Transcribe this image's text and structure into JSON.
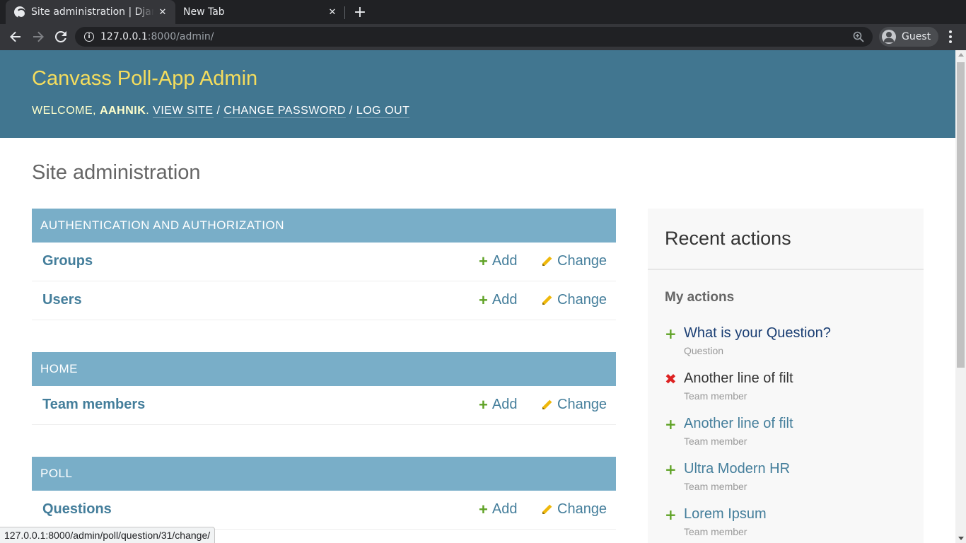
{
  "browser": {
    "tabs": [
      {
        "title": "Site administration | Django site admin",
        "active": true
      },
      {
        "title": "New Tab",
        "active": false
      }
    ],
    "url_host": "127.0.0.1",
    "url_rest": ":8000/admin/",
    "profile_name": "Guest",
    "status_url": "127.0.0.1:8000/admin/poll/question/31/change/"
  },
  "header": {
    "branding": "Canvass Poll-App Admin",
    "welcome": "WELCOME, ",
    "username": "AAHNIK",
    "links": {
      "view_site": "VIEW SITE",
      "change_password": "CHANGE PASSWORD",
      "log_out": "LOG OUT"
    },
    "separator": " / "
  },
  "main": {
    "title": "Site administration",
    "action_add": "Add",
    "action_change": "Change",
    "modules": [
      {
        "caption": "AUTHENTICATION AND AUTHORIZATION",
        "models": [
          "Groups",
          "Users"
        ]
      },
      {
        "caption": "HOME",
        "models": [
          "Team members"
        ]
      },
      {
        "caption": "POLL",
        "models": [
          "Questions"
        ]
      }
    ]
  },
  "recent": {
    "title": "Recent actions",
    "subtitle": "My actions",
    "items": [
      {
        "label": "What is your Question?",
        "type": "Question",
        "action": "add",
        "icon": "plus-icon"
      },
      {
        "label": "Another line of filt",
        "type": "Team member",
        "action": "delete",
        "icon": "x-icon"
      },
      {
        "label": "Another line of filt",
        "type": "Team member",
        "action": "add",
        "icon": "plus-icon"
      },
      {
        "label": "Ultra Modern HR",
        "type": "Team member",
        "action": "add",
        "icon": "plus-icon"
      },
      {
        "label": "Lorem Ipsum",
        "type": "Team member",
        "action": "add",
        "icon": "plus-icon"
      }
    ]
  },
  "colors": {
    "header_bg": "#417690",
    "branding": "#f5dd5d",
    "module_caption_bg": "#79aec8",
    "link": "#447e9b",
    "add_green": "#5fa225",
    "delete_red": "#dd2222"
  }
}
